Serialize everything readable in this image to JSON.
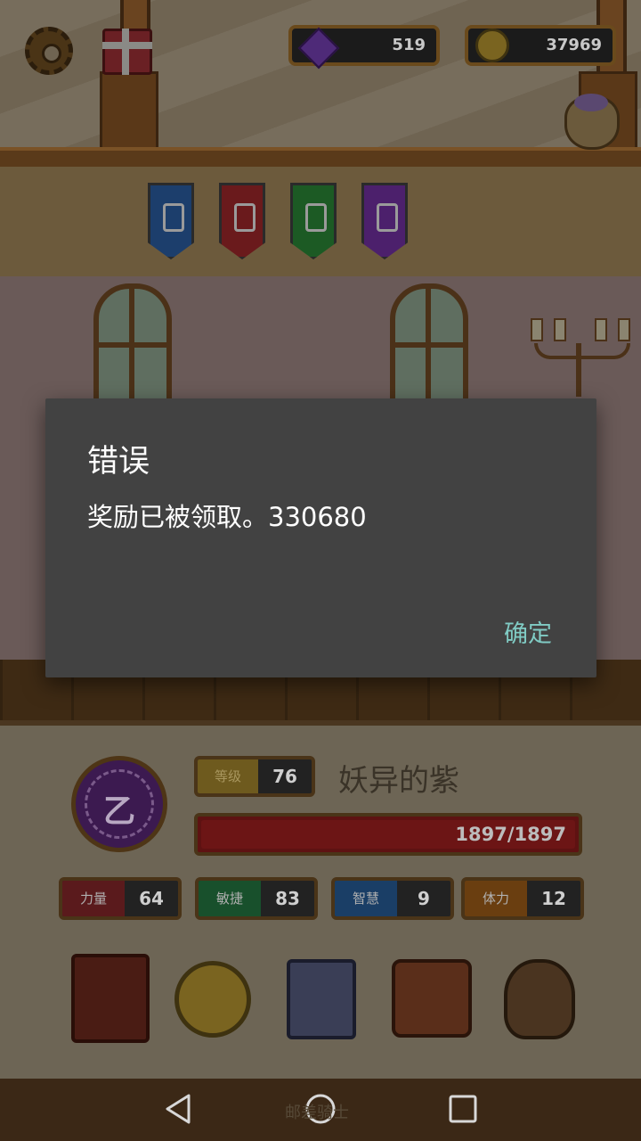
{
  "hud": {
    "gems": "519",
    "coins": "37969"
  },
  "character": {
    "emblem_symbol": "乙",
    "level_label": "等级",
    "level_value": "76",
    "name": "妖异的紫",
    "hp_text": "1897/1897",
    "hp_fraction": 1.0
  },
  "stats": [
    {
      "label": "力量",
      "value": "64",
      "color": "#5a1a1c"
    },
    {
      "label": "敏捷",
      "value": "83",
      "color": "#18502c"
    },
    {
      "label": "智慧",
      "value": "9",
      "color": "#1a3e66"
    },
    {
      "label": "体力",
      "value": "12",
      "color": "#6a3e10"
    }
  ],
  "menu_icons": [
    "spellbook-icon",
    "star-coin-icon",
    "card-deck-icon",
    "backpack-icon",
    "treasure-sack-icon"
  ],
  "banners": [
    {
      "name": "blue-banner",
      "color": "#1c3e6c"
    },
    {
      "name": "red-banner",
      "color": "#6a1a1c"
    },
    {
      "name": "green-banner",
      "color": "#1c5a24"
    },
    {
      "name": "purple-banner",
      "color": "#4c206c"
    }
  ],
  "dialog": {
    "title": "错误",
    "message": "奖励已被领取。330680",
    "ok_label": "确定"
  },
  "watermark": "邮差骑士",
  "colors": {
    "dialog_bg": "#424242",
    "dialog_accent": "#80cbc4"
  }
}
